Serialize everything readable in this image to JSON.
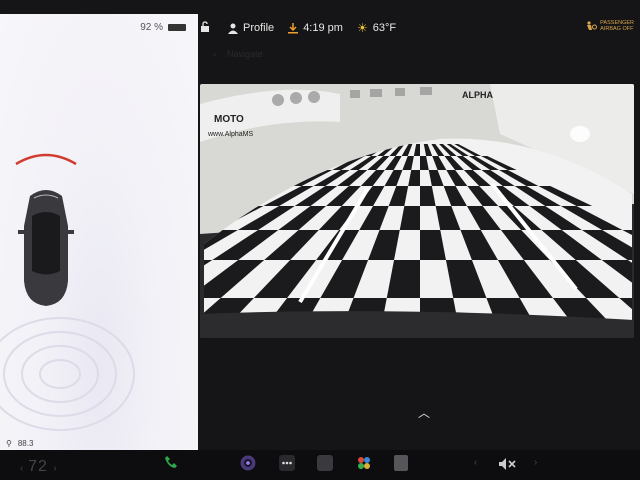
{
  "battery": {
    "percent": "92 %"
  },
  "status": {
    "profile_label": "Profile",
    "time": "4:19 pm",
    "temperature": "63°F",
    "airbag_line1": "PASSENGER",
    "airbag_line2": "AIRBAG OFF"
  },
  "navigate": {
    "label": "Navigate"
  },
  "camera": {
    "banner_text": "MOTO",
    "banner_url": "www.AlphaMS",
    "banner_right": "ALPHA"
  },
  "car_panel": {
    "odometer": "88.3"
  },
  "dock": {
    "temperature": "72"
  },
  "colors": {
    "arc": "#d23b2f",
    "airbag": "#d9a44a",
    "accent": "#6b54d6"
  },
  "icons": [
    "lock-icon",
    "person-icon",
    "download-icon",
    "sun-icon",
    "airbag-icon",
    "search-icon",
    "chevron-up-icon",
    "phone-icon",
    "camera-app-icon",
    "more-icon",
    "toybox-icon",
    "apps-icon",
    "calendar-icon",
    "mute-icon"
  ]
}
